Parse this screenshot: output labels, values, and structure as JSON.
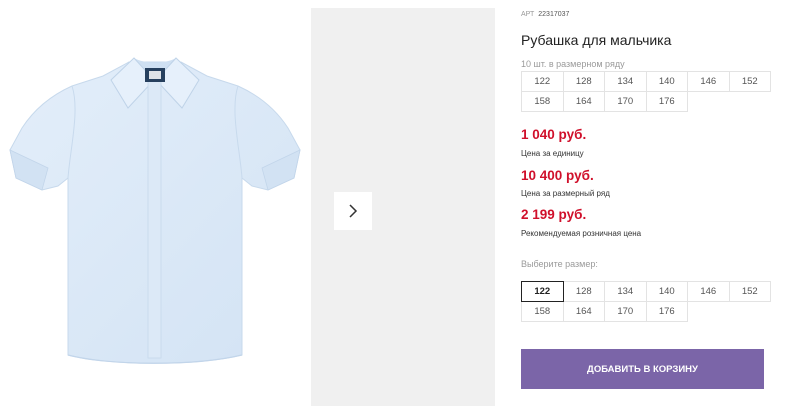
{
  "product": {
    "art_label": "АРТ",
    "art_value": "22317037",
    "title": "Рубашка для мальчика"
  },
  "pack_note": "10 шт. в размерном ряду",
  "pack_sizes": [
    "122",
    "128",
    "134",
    "140",
    "146",
    "152",
    "158",
    "164",
    "170",
    "176"
  ],
  "prices": {
    "unit_price": "1 040 руб.",
    "unit_label": "Цена за единицу",
    "pack_price": "10 400 руб.",
    "pack_label": "Цена за размерный ряд",
    "retail_price": "2 199 руб.",
    "retail_label": "Рекомендуемая розничная цена"
  },
  "size_select": {
    "label": "Выберите размер:",
    "selected": "122",
    "options": [
      "122",
      "128",
      "134",
      "140",
      "146",
      "152",
      "158",
      "164",
      "170",
      "176"
    ]
  },
  "add_to_cart_label": "ДОБАВИТЬ В КОРЗИНУ",
  "icons": {
    "next": "chevron-right-icon"
  },
  "colors": {
    "price": "#d0102b",
    "button": "#7b65a8",
    "shirt": "#dbe9f7"
  }
}
